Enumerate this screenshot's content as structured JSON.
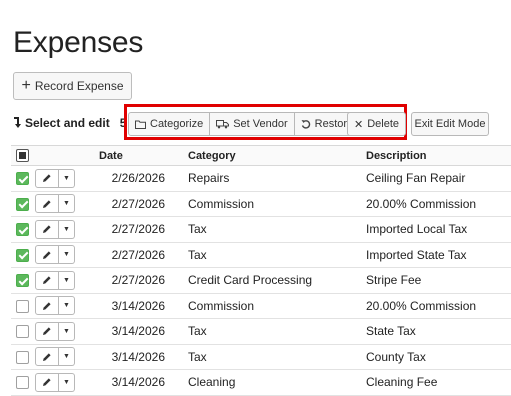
{
  "page": {
    "title": "Expenses"
  },
  "actions": {
    "record_expense": "Record Expense"
  },
  "select_edit": {
    "label": "Select and edit",
    "count": "5"
  },
  "toolbar": {
    "categorize": "Categorize",
    "set_vendor": "Set Vendor",
    "restore": "Restore",
    "delete": "Delete",
    "exit_edit_mode": "Exit Edit Mode"
  },
  "colors": {
    "highlight": "#e00000",
    "checked": "#5cb85c"
  },
  "table": {
    "headers": {
      "date": "Date",
      "category": "Category",
      "description": "Description"
    },
    "rows": [
      {
        "checked": true,
        "date": "2/26/2026",
        "category": "Repairs",
        "description": "Ceiling Fan Repair"
      },
      {
        "checked": true,
        "date": "2/27/2026",
        "category": "Commission",
        "description": "20.00% Commission"
      },
      {
        "checked": true,
        "date": "2/27/2026",
        "category": "Tax",
        "description": "Imported Local Tax"
      },
      {
        "checked": true,
        "date": "2/27/2026",
        "category": "Tax",
        "description": "Imported State Tax"
      },
      {
        "checked": true,
        "date": "2/27/2026",
        "category": "Credit Card Processing",
        "description": "Stripe Fee"
      },
      {
        "checked": false,
        "date": "3/14/2026",
        "category": "Commission",
        "description": "20.00% Commission"
      },
      {
        "checked": false,
        "date": "3/14/2026",
        "category": "Tax",
        "description": "State Tax"
      },
      {
        "checked": false,
        "date": "3/14/2026",
        "category": "Tax",
        "description": "County Tax"
      },
      {
        "checked": false,
        "date": "3/14/2026",
        "category": "Cleaning",
        "description": "Cleaning Fee"
      }
    ]
  }
}
